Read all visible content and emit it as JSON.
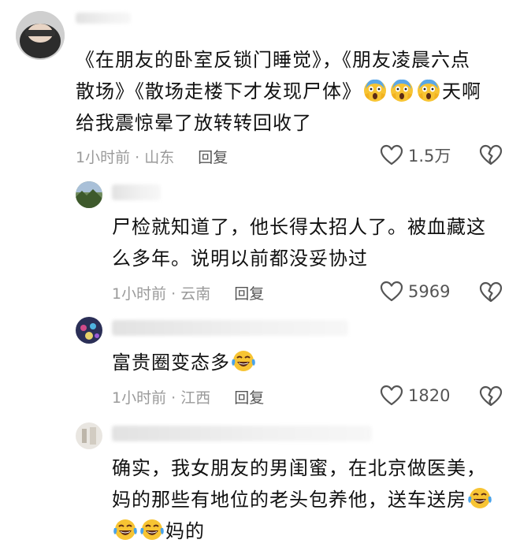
{
  "comments": [
    {
      "text_lines": [
        "《在朋友的卧室反锁门睡觉》，《朋友凌晨六点",
        "散场》《散场走楼下才发现尸体》",
        "给我震惊晕了放转转回收了"
      ],
      "after_emoji": "天啊",
      "time": "1小时前 · 山东",
      "reply": "回复",
      "likes": "1.5万",
      "emojis": [
        "scream-emoji",
        "scream-emoji",
        "scream-emoji"
      ]
    },
    {
      "text_lines": [
        "尸检就知道了，他长得太招人了。被血藏这",
        "么多年。说明以前都没妥协过"
      ],
      "time": "1小时前 · 云南",
      "reply": "回复",
      "likes": "5969"
    },
    {
      "text_lines": [
        "富贵圈变态多"
      ],
      "time": "1小时前 · 江西",
      "reply": "回复",
      "likes": "1820",
      "emojis": [
        "laugh-cry-emoji"
      ]
    },
    {
      "text_lines": [
        "确实，我女朋友的男闺蜜，在北京做医美，",
        "妈的那些有地位的老头包养他，送车送房",
        "妈的"
      ],
      "emojis": [
        "laugh-cry-emoji",
        "laugh-cry-emoji",
        "laugh-cry-emoji"
      ]
    }
  ],
  "colors": {
    "text": "#111111",
    "meta": "#9a9a9a",
    "icon": "#555555"
  }
}
